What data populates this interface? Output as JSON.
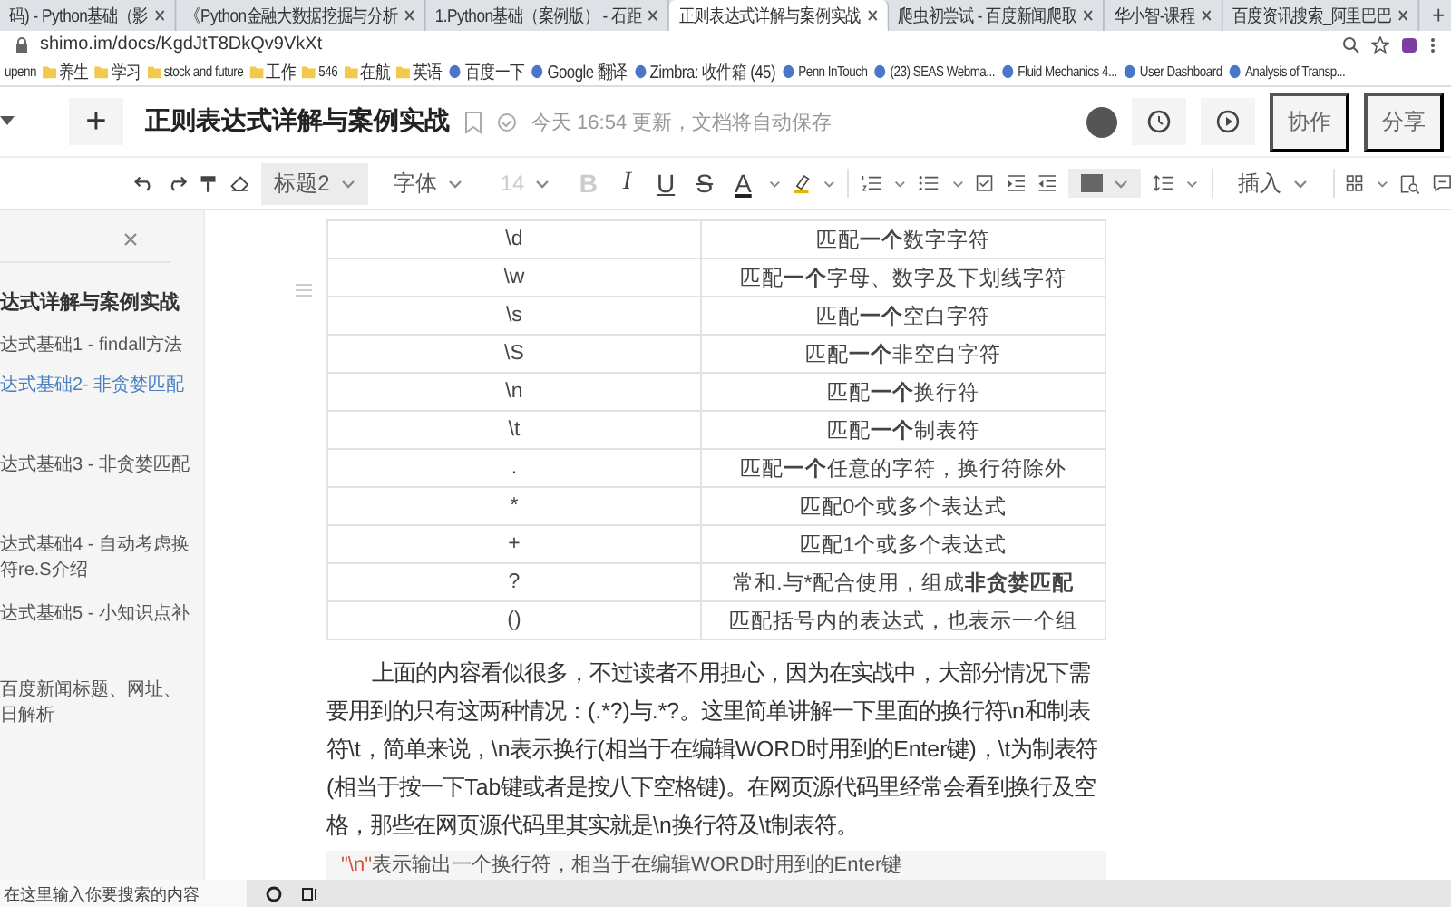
{
  "browser": {
    "tabs": [
      {
        "title": "码) - Python基础（影",
        "selected": false
      },
      {
        "title": "《Python金融大数据挖掘与分析",
        "selected": false
      },
      {
        "title": "1.Python基础（案例版） - 石距",
        "selected": false
      },
      {
        "title": "正则表达式详解与案例实战",
        "selected": true
      },
      {
        "title": "爬虫初尝试 - 百度新闻爬取",
        "selected": false
      },
      {
        "title": "华小智-课程",
        "selected": false
      },
      {
        "title": "百度资讯搜索_阿里巴巴",
        "selected": false
      }
    ],
    "new_tab": "+",
    "address": "shimo.im/docs/KgdJtT8DkQv9VkXt",
    "bookmarks": [
      {
        "label": "upenn",
        "kind": "plain"
      },
      {
        "label": "养生",
        "kind": "folder"
      },
      {
        "label": "学习",
        "kind": "folder"
      },
      {
        "label": "stock and future",
        "kind": "folder"
      },
      {
        "label": "工作",
        "kind": "folder"
      },
      {
        "label": "546",
        "kind": "folder"
      },
      {
        "label": "在航",
        "kind": "folder"
      },
      {
        "label": "英语",
        "kind": "folder"
      },
      {
        "label": "百度一下",
        "kind": "site"
      },
      {
        "label": "Google 翻译",
        "kind": "site"
      },
      {
        "label": "Zimbra: 收件箱 (45)",
        "kind": "site"
      },
      {
        "label": "Penn InTouch",
        "kind": "site"
      },
      {
        "label": "(23) SEAS Webma...",
        "kind": "site"
      },
      {
        "label": "Fluid Mechanics 4...",
        "kind": "site"
      },
      {
        "label": "User Dashboard",
        "kind": "site"
      },
      {
        "label": "Analysis of Transp...",
        "kind": "site"
      }
    ]
  },
  "doc": {
    "new_button": "+",
    "title": "正则表达式详解与案例实战",
    "status": "今天 16:54 更新，文档将自动保存",
    "actions": [
      "协作",
      "分享"
    ]
  },
  "toolbar": {
    "heading_style": "标题2",
    "font": "字体",
    "font_size": {
      "label": "14",
      "disabled": true
    },
    "format_buttons": [
      {
        "label": "B",
        "kind": "bold",
        "disabled": true
      },
      {
        "label": "I",
        "kind": "italic",
        "disabled": false
      },
      {
        "label": "U",
        "kind": "underline",
        "disabled": false
      },
      {
        "label": "S",
        "kind": "strike",
        "disabled": false
      },
      {
        "label": "A",
        "kind": "color",
        "disabled": false
      }
    ],
    "insert": "插入"
  },
  "outline": {
    "title": "达式详解与案例实战",
    "children": [
      {
        "text": "达式基础1 - findall方法",
        "selected": false
      },
      {
        "text": "达式基础2- 非贪婪匹配",
        "selected": true
      },
      {
        "text": "达式基础3 - 非贪婪匹配",
        "selected": false
      },
      {
        "text": "达式基础4 - 自动考虑换符re.S介绍",
        "selected": false
      },
      {
        "text": "达式基础5 - 小知识点补",
        "selected": false
      },
      {
        "text": "百度新闻标题、网址、日解析",
        "selected": false
      }
    ]
  },
  "table": {
    "rows": [
      [
        "\\d",
        "匹配**一个**数字字符"
      ],
      [
        "\\w",
        "匹配**一个**字母、数字及下划线字符"
      ],
      [
        "\\s",
        "匹配**一个**空白字符"
      ],
      [
        "\\S",
        "匹配**一个**非空白字符"
      ],
      [
        "\\n",
        "匹配**一个**换行符"
      ],
      [
        "\\t",
        "匹配**一个**制表符"
      ],
      [
        ".",
        "匹配**一个**任意的字符，换行符除外"
      ],
      [
        "*",
        "匹配0个或多个表达式"
      ],
      [
        "+",
        "匹配1个或多个表达式"
      ],
      [
        "?",
        "常和.与*配合使用，组成**非贪婪匹配**"
      ],
      [
        "()",
        "匹配括号内的表达式，也表示一个组"
      ]
    ]
  },
  "paragraph": "上面的内容看似很多，不过读者不用担心，因为在实战中，大部分情况下需要用到的只有这两种情况：(.*?)与.*?。这里简单讲解一下里面的换行符\\n和制表符\\t，简单来说，\\n表示换行(相当于在编辑WORD时用到的Enter键)，\\t为制表符(相当于按一下Tab键或者是按八下空格键)。在网页源代码里经常会看到换行及空格，那些在网页源代码里其实就是\\n换行符及\\t制表符。",
  "code_block": {
    "token": "\"\\n\"",
    "comment": "表示输出一个换行符，相当于在编辑WORD时用到的Enter键"
  },
  "taskbar": {
    "search_placeholder": "在这里输入你要搜索的内容"
  }
}
